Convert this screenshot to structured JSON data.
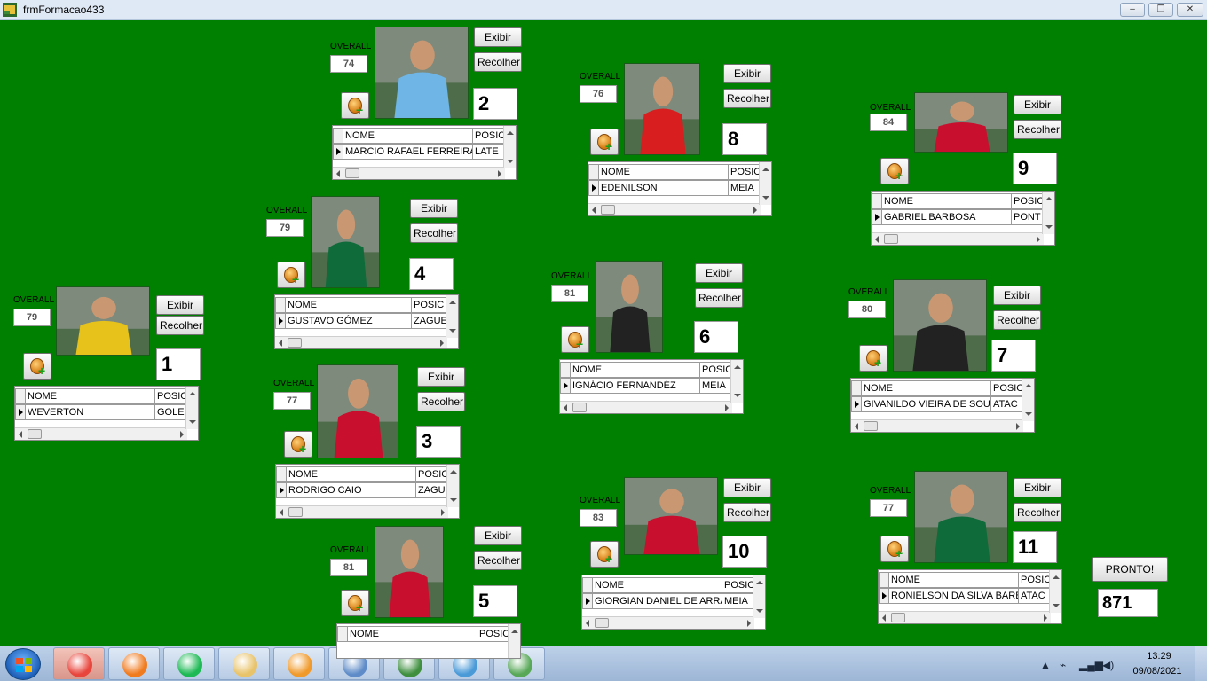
{
  "window": {
    "title": "frmFormacao433",
    "minimize": "–",
    "maximize": "❐",
    "close": "✕"
  },
  "common": {
    "overall_label": "OVERALL",
    "exibir": "Exibir",
    "recolher": "Recolher",
    "col_nome": "NOME",
    "col_posicao": "POSIC"
  },
  "players": [
    {
      "number": "1",
      "overall": "79",
      "nome": "WEVERTON",
      "posicao": "GOLE",
      "shirt_color": "#e6c21a"
    },
    {
      "number": "2",
      "overall": "74",
      "nome": "MARCIO RAFAEL FERREIRA D",
      "posicao": "LATE",
      "shirt_color": "#6fb6e6"
    },
    {
      "number": "3",
      "overall": "77",
      "nome": "RODRIGO CAIO",
      "posicao": "ZAGU",
      "shirt_color": "#c8102e"
    },
    {
      "number": "4",
      "overall": "79",
      "nome": "GUSTAVO GÓMEZ",
      "posicao": "ZAGUE",
      "shirt_color": "#0f6b3a"
    },
    {
      "number": "5",
      "overall": "81",
      "nome": "",
      "posicao": "",
      "shirt_color": "#c8102e"
    },
    {
      "number": "6",
      "overall": "81",
      "nome": "IGNÁCIO FERNANDÉZ",
      "posicao": "MEIA",
      "shirt_color": "#222222"
    },
    {
      "number": "7",
      "overall": "80",
      "nome": "GIVANILDO VIEIRA DE SOUZA",
      "posicao": "ATAC",
      "shirt_color": "#222222"
    },
    {
      "number": "8",
      "overall": "76",
      "nome": "EDENILSON",
      "posicao": "MEIA",
      "shirt_color": "#d81e1e"
    },
    {
      "number": "9",
      "overall": "84",
      "nome": "GABRIEL BARBOSA",
      "posicao": "PONT",
      "shirt_color": "#c8102e"
    },
    {
      "number": "10",
      "overall": "83",
      "nome": "GIORGIAN DANIEL DE ARRAS",
      "posicao": "MEIA",
      "shirt_color": "#c8102e"
    },
    {
      "number": "11",
      "overall": "77",
      "nome": "RONIELSON DA SILVA BARBO",
      "posicao": "ATAC",
      "shirt_color": "#0f6b3a"
    }
  ],
  "pronto_label": "PRONTO!",
  "total": "871",
  "taskbar": {
    "time": "13:29",
    "date": "09/08/2021",
    "items": [
      "chrome-icon",
      "firefox-icon",
      "spotify-icon",
      "folder-icon",
      "media-player-icon",
      "app-form-icon",
      "photo-app-icon",
      "image-viewer-icon",
      "network-app-icon"
    ]
  }
}
